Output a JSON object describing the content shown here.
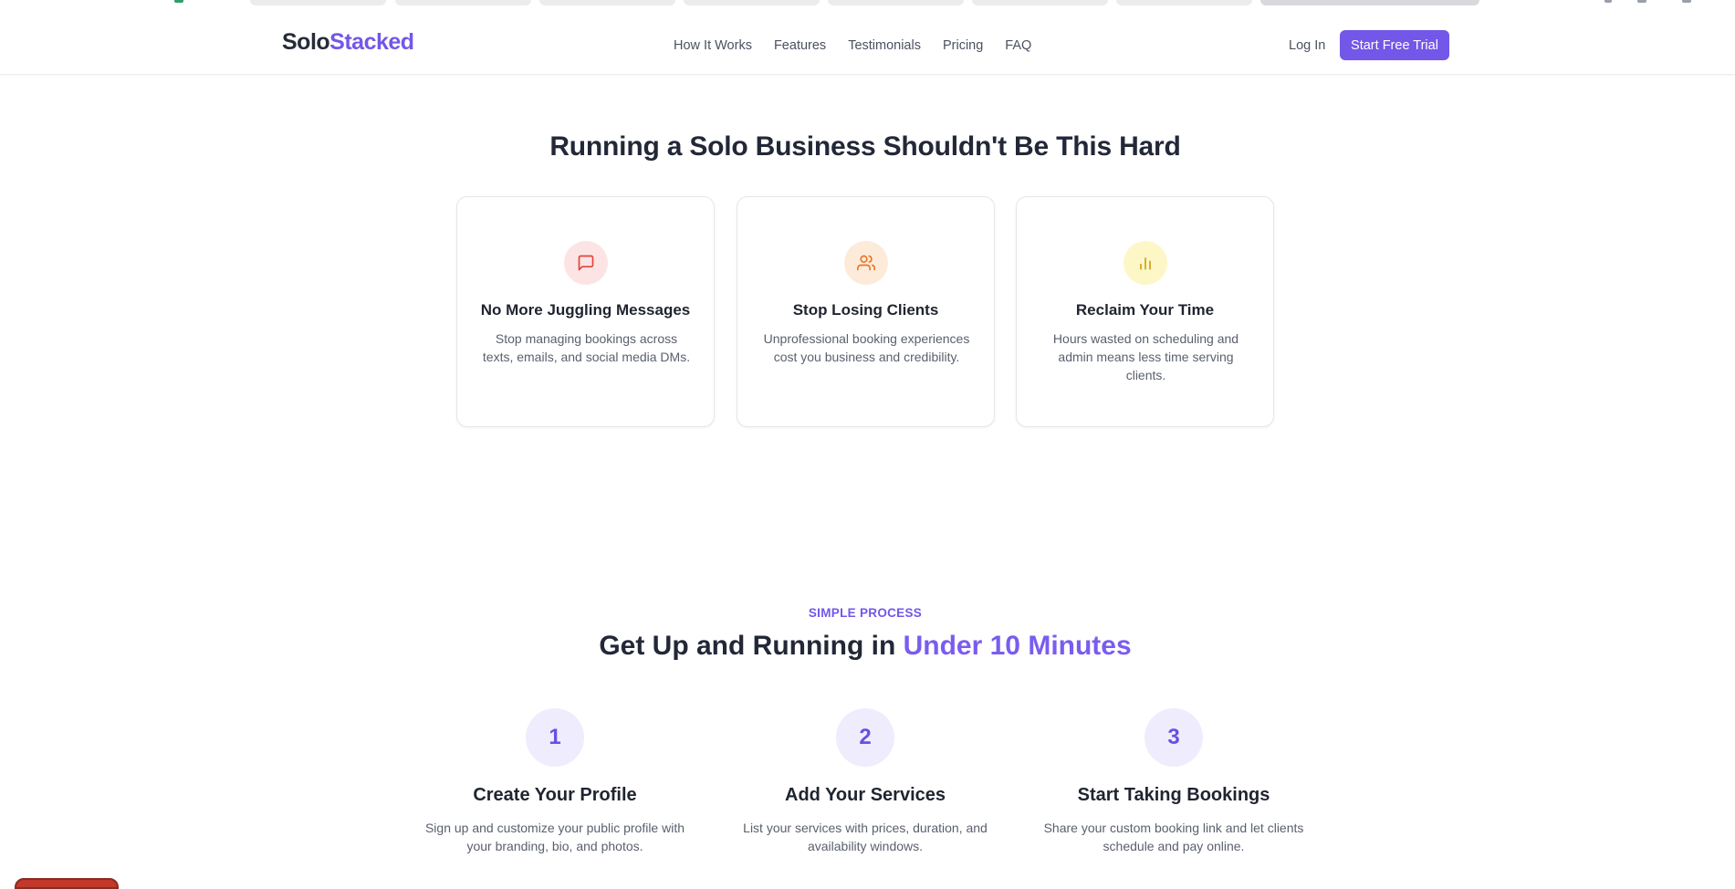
{
  "brand": {
    "part1": "Solo",
    "part2": "Stacked"
  },
  "nav": {
    "links": [
      "How It Works",
      "Features",
      "Testimonials",
      "Pricing",
      "FAQ"
    ],
    "login": "Log In",
    "cta": "Start Free Trial"
  },
  "problem": {
    "heading": "Running a Solo Business Shouldn't Be This Hard",
    "cards": [
      {
        "icon": "message-square-icon",
        "title": "No More Juggling Messages",
        "text": "Stop managing bookings across texts, emails, and social media DMs."
      },
      {
        "icon": "users-icon",
        "title": "Stop Losing Clients",
        "text": "Unprofessional booking experiences cost you business and credibility."
      },
      {
        "icon": "bar-chart-icon",
        "title": "Reclaim Your Time",
        "text": "Hours wasted on scheduling and admin means less time serving clients."
      }
    ]
  },
  "process": {
    "eyebrow": "SIMPLE PROCESS",
    "heading_main": "Get Up and Running in ",
    "heading_accent": "Under 10 Minutes",
    "steps": [
      {
        "num": "1",
        "title": "Create Your Profile",
        "text": "Sign up and customize your public profile with your branding, bio, and photos."
      },
      {
        "num": "2",
        "title": "Add Your Services",
        "text": "List your services with prices, duration, and availability windows."
      },
      {
        "num": "3",
        "title": "Start Taking Bookings",
        "text": "Share your custom booking link and let clients schedule and pay online."
      }
    ]
  },
  "colors": {
    "accent": "#7357e8",
    "heading": "#232838",
    "card_red_bg": "#fde4e4",
    "card_orange_bg": "#fdebd9",
    "card_yellow_bg": "#fdf7c8"
  }
}
